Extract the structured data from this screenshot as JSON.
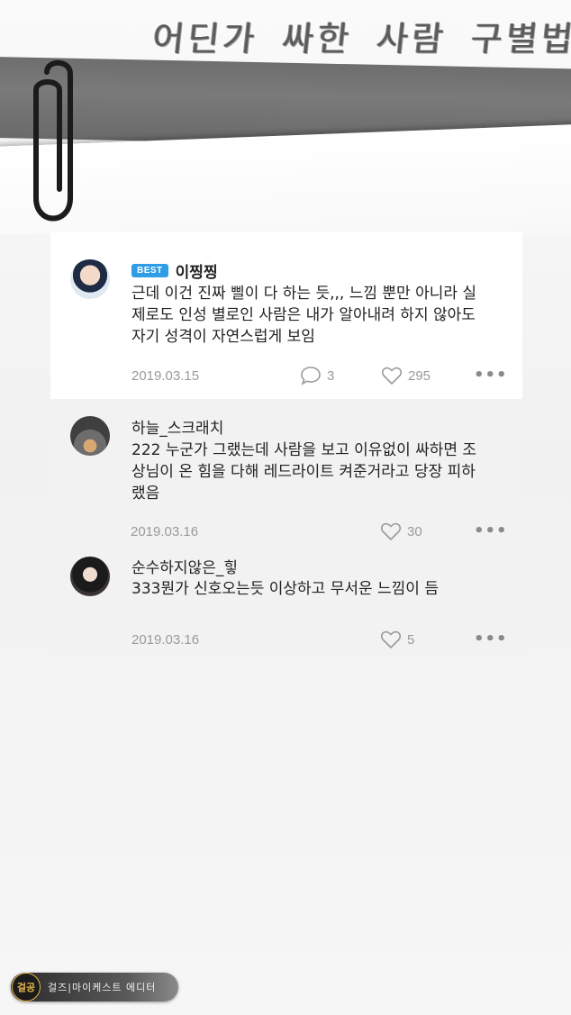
{
  "header": {
    "title": "어딘가 싸한 사람 구별법"
  },
  "comments": [
    {
      "badge": "BEST",
      "username": "이찡찡",
      "lines": [
        "근데 이건 진짜 삘이 다 하는 듯,,, 느낌 뿐만 아니라 실",
        "제로도 인성 별로인 사람은 내가 알아내려 하지 않아도",
        "자기 성격이 자연스럽게 보임"
      ],
      "date": "2019.03.15",
      "reply_count": "3",
      "likes": "295"
    },
    {
      "username": "하늘_스크래치",
      "lines": [
        "222 누군가 그랬는데 사람을 보고 이유없이 싸하면 조",
        "상님이 온 힘을 다해 레드라이트 켜준거라고 당장 피하",
        "랬음"
      ],
      "date": "2019.03.16",
      "likes": "30"
    },
    {
      "username": "순수하지않은_힣",
      "lines": [
        "333뭔가 신호오는듯 이상하고 무서운 느낌이 듬"
      ],
      "date": "2019.03.16",
      "likes": "5"
    }
  ],
  "footer": {
    "badge": "걸공",
    "label": "걸즈|마이케스트 에디터"
  },
  "icons": {
    "comment": "comment-bubble-icon",
    "like": "heart-icon",
    "more": "more-dots-icon",
    "clip": "paperclip-icon"
  },
  "colors": {
    "best_badge": "#2f9ce6",
    "tape": "#6e6e6e"
  }
}
